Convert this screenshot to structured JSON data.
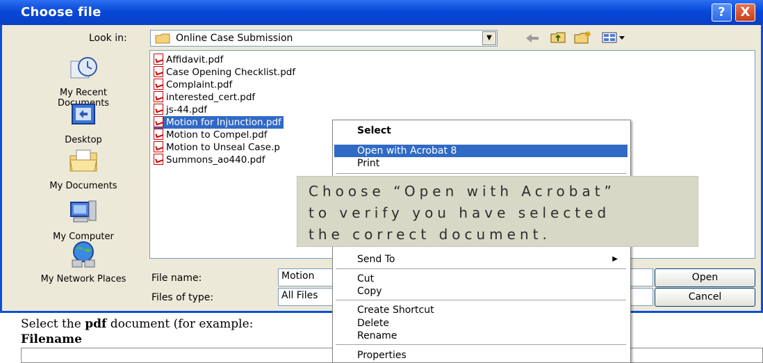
{
  "dialog": {
    "title": "Choose file",
    "help_label": "?",
    "close_label": "X"
  },
  "look_in": {
    "label": "Look in:",
    "value": "Online Case Submission"
  },
  "places": [
    {
      "label": "My Recent Documents",
      "icon": "recent-documents-icon"
    },
    {
      "label": "Desktop",
      "icon": "desktop-icon"
    },
    {
      "label": "My Documents",
      "icon": "my-documents-icon"
    },
    {
      "label": "My Computer",
      "icon": "my-computer-icon"
    },
    {
      "label": "My Network Places",
      "icon": "network-places-icon"
    }
  ],
  "files": [
    {
      "name": "Affidavit.pdf",
      "selected": false
    },
    {
      "name": "Case Opening Checklist.pdf",
      "selected": false
    },
    {
      "name": "Complaint.pdf",
      "selected": false
    },
    {
      "name": "interested_cert.pdf",
      "selected": false
    },
    {
      "name": "js-44.pdf",
      "selected": false
    },
    {
      "name": "Motion for Injunction.pdf",
      "selected": true
    },
    {
      "name": "Motion to Compel.pdf",
      "selected": false
    },
    {
      "name": "Motion to Unseal Case.p",
      "selected": false
    },
    {
      "name": "Summons_ao440.pdf",
      "selected": false
    }
  ],
  "file_name": {
    "label": "File name:",
    "value": "Motion"
  },
  "file_type": {
    "label": "Files of type:",
    "value": "All Files"
  },
  "buttons": {
    "open": "Open",
    "cancel": "Cancel"
  },
  "context_menu": {
    "items": [
      {
        "label": "Select",
        "bold": true
      },
      {
        "label": "Open with Acrobat 8",
        "highlighted": true
      },
      {
        "label": "Print"
      },
      {
        "label": "Send To",
        "submenu": true
      },
      {
        "label": "Cut"
      },
      {
        "label": "Copy"
      },
      {
        "label": "Create Shortcut"
      },
      {
        "label": "Delete"
      },
      {
        "label": "Rename"
      },
      {
        "label": "Properties"
      }
    ]
  },
  "callout": {
    "line1": "Choose “Open with Acrobat”",
    "line2": "to verify you have selected",
    "line3": "the correct document."
  },
  "page": {
    "instruction": "Select the ",
    "instruction_bold": "pdf",
    "instruction_rest": " document (for example:",
    "filename_label": "Filename"
  },
  "colors": {
    "titlebar": "#0a48d8",
    "selection": "#316ac5",
    "dialog_bg": "#ece9d8",
    "callout_bg": "#d8d8c6"
  }
}
